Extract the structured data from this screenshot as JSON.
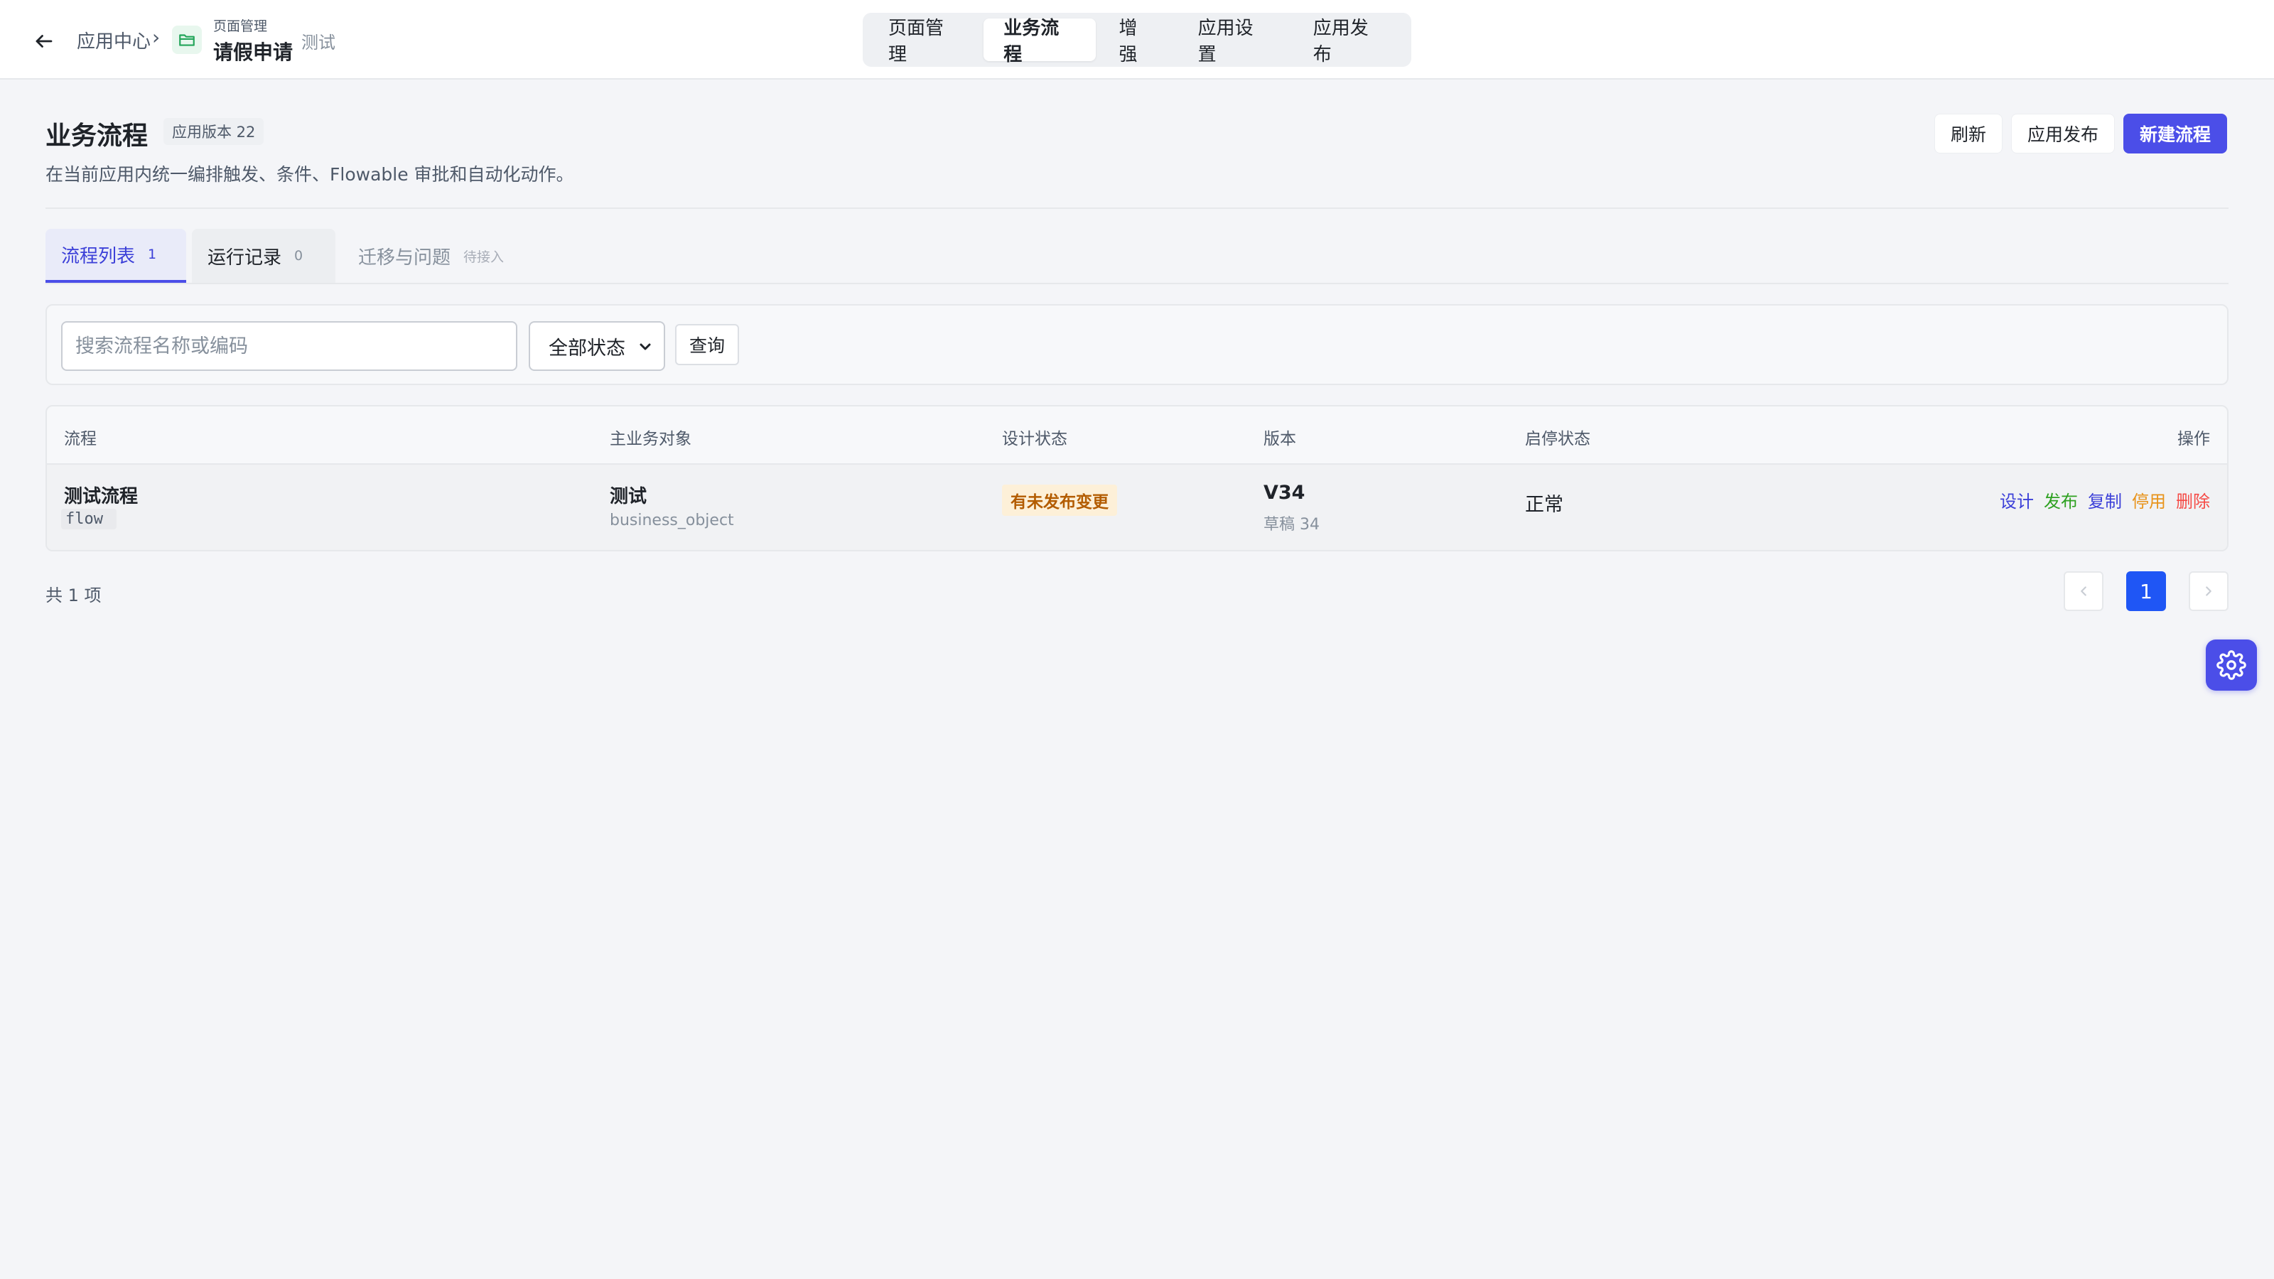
{
  "colors": {
    "primary": "#4b4ee8",
    "page_current": "#1f56f5",
    "warning_bg": "#fdf0d8",
    "warning_text": "#b35c00",
    "op_design": "#3b3fd8",
    "op_publish": "#2ea121",
    "op_copy": "#3b3fd8",
    "op_disable": "#e8931a",
    "op_delete": "#f54a45"
  },
  "breadcrumb": {
    "root": "应用中心",
    "separator": "›",
    "group": "页面管理",
    "page": "请假申请",
    "env": "测试"
  },
  "top_tabs": [
    {
      "label": "页面管理",
      "active": false
    },
    {
      "label": "业务流程",
      "active": true
    },
    {
      "label": "增强",
      "active": false
    },
    {
      "label": "应用设置",
      "active": false
    },
    {
      "label": "应用发布",
      "active": false
    }
  ],
  "header": {
    "title": "业务流程",
    "version_chip": "应用版本 22",
    "description": "在当前应用内统一编排触发、条件、Flowable 审批和自动化动作。",
    "refresh_label": "刷新",
    "publish_label": "应用发布",
    "new_flow_label": "新建流程"
  },
  "sub_tabs": [
    {
      "label": "流程列表",
      "count": "1"
    },
    {
      "label": "运行记录",
      "count": "0"
    },
    {
      "label": "迁移与问题",
      "count": "待接入"
    }
  ],
  "filters": {
    "search_placeholder": "搜索流程名称或编码",
    "search_value": "",
    "status_selected": "全部状态",
    "query_label": "查询"
  },
  "table": {
    "columns": {
      "flow": "流程",
      "biz_object": "主业务对象",
      "design_status": "设计状态",
      "version": "版本",
      "enable_status": "启停状态",
      "actions": "操作"
    },
    "rows": [
      {
        "flow_name": "测试流程",
        "flow_code": "flow",
        "biz_object_name": "测试",
        "biz_object_code": "business_object",
        "design_status": "有未发布变更",
        "version": "V34",
        "draft": "草稿 34",
        "enable_status": "正常",
        "actions": {
          "design": "设计",
          "publish": "发布",
          "copy": "复制",
          "disable": "停用",
          "delete": "删除"
        }
      }
    ]
  },
  "pagination": {
    "total_text": "共 1 项",
    "current_page": "1"
  },
  "icons": {
    "back": "arrow-left-icon",
    "folder": "folder-icon",
    "select": "chevron-down-icon",
    "prev": "chevron-left-icon",
    "next": "chevron-right-icon",
    "float": "gear-icon"
  }
}
